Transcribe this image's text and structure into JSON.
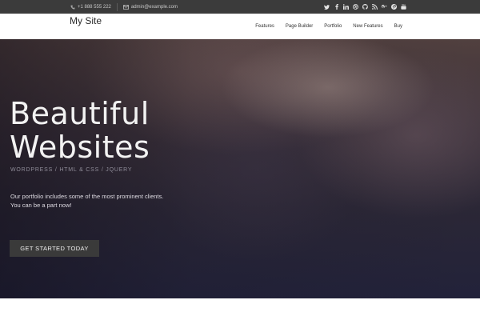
{
  "topbar": {
    "phone": "+1 888 555 222",
    "email": "admin@example.com",
    "social_icons": [
      "twitter-icon",
      "facebook-icon",
      "linkedin-icon",
      "dribbble-icon",
      "github-icon",
      "rss-icon",
      "google-plus-icon",
      "pinterest-icon",
      "youtube-icon"
    ]
  },
  "header": {
    "brand": "My Site",
    "nav": [
      {
        "label": "Features",
        "active": true
      },
      {
        "label": "Page Builder"
      },
      {
        "label": "Portfolio"
      },
      {
        "label": "New Features"
      },
      {
        "label": "Buy"
      }
    ],
    "accent_color": "#a4c46a"
  },
  "hero": {
    "title_line1": "Beautiful",
    "title_line2": "Websites",
    "subtitle": "WORDPRESS / HTML & CSS / JQUERY",
    "desc_line1": "Our portfolio includes some of the most prominent clients.",
    "desc_line2": "You can be a part now!",
    "cta_label": "GET STARTED TODAY"
  }
}
